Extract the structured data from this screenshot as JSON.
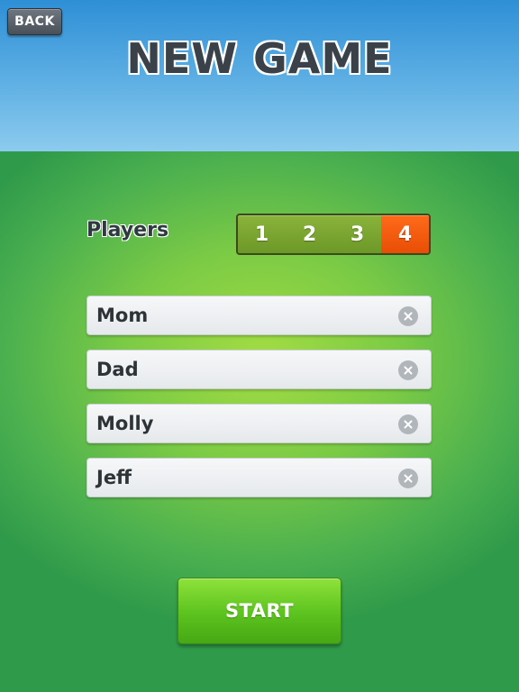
{
  "header": {
    "back_label": "BACK",
    "title": "NEW GAME"
  },
  "players": {
    "label": "Players",
    "options": [
      "1",
      "2",
      "3",
      "4"
    ],
    "selected": "4"
  },
  "names": [
    {
      "value": "Mom"
    },
    {
      "value": "Dad"
    },
    {
      "value": "Molly"
    },
    {
      "value": "Jeff"
    }
  ],
  "start_label": "START",
  "colors": {
    "active_segment": "#f05a0c",
    "start_button": "#5cc21e",
    "title_text": "#3a4148"
  }
}
